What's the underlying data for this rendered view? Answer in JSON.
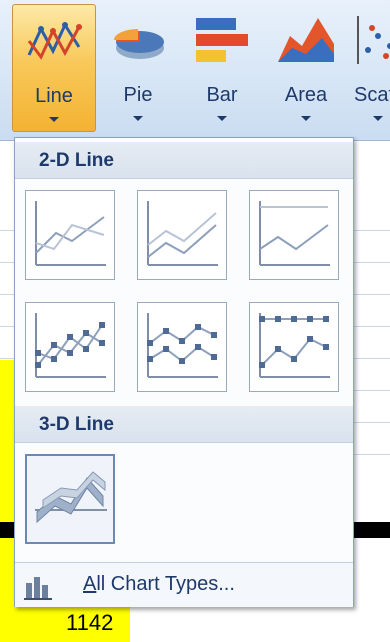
{
  "ribbon": {
    "buttons": [
      {
        "label": "Line",
        "icon": "line-chart-icon",
        "active": true
      },
      {
        "label": "Pie",
        "icon": "pie-chart-icon"
      },
      {
        "label": "Bar",
        "icon": "bar-chart-icon"
      },
      {
        "label": "Area",
        "icon": "area-chart-icon"
      },
      {
        "label": "Scat",
        "icon": "scatter-chart-icon"
      }
    ]
  },
  "dropdown": {
    "section_2d": "2-D Line",
    "section_3d": "3-D Line",
    "thumbnails_2d": [
      {
        "icon": "line-thumbnail-icon"
      },
      {
        "icon": "stacked-line-thumbnail-icon"
      },
      {
        "icon": "100-percent-stacked-line-thumbnail-icon"
      },
      {
        "icon": "line-with-markers-thumbnail-icon"
      },
      {
        "icon": "stacked-line-with-markers-thumbnail-icon"
      },
      {
        "icon": "100-percent-stacked-line-with-markers-thumbnail-icon"
      }
    ],
    "thumbnails_3d": [
      {
        "icon": "3d-line-thumbnail-icon"
      }
    ],
    "all_chart_types_prefix": "A",
    "all_chart_types_rest": "ll Chart Types..."
  },
  "sheet": {
    "cell_value": "1142"
  },
  "colors": {
    "ribbon_bg": "#dce8f6",
    "active_button": "#f8c95a",
    "highlight_cell": "#ffff00",
    "label_text": "#1d3a6a"
  }
}
